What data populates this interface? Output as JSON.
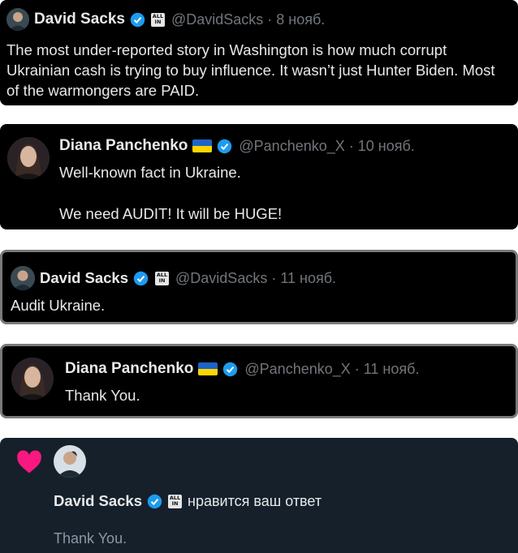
{
  "tweets": [
    {
      "name": "David Sacks",
      "handle": "@DavidSacks",
      "date": "· 8 нояб.",
      "text": "The most under-reported story in Washington is how much corrupt Ukrainian cash is trying to buy influence. It wasn’t just Hunter Biden. Most of the warmongers are PAID.",
      "badge": "ALL IN"
    },
    {
      "name": "Diana Panchenko",
      "handle": "@Panchenko_X",
      "date": "· 10 нояб.",
      "text": "Well-known fact in Ukraine.\n\nWe need AUDIT! It will be HUGE!"
    },
    {
      "name": "David Sacks",
      "handle": "@DavidSacks",
      "date": "· 11 нояб.",
      "text": "Audit Ukraine.",
      "badge": "ALL IN"
    },
    {
      "name": "Diana Panchenko",
      "handle": "@Panchenko_X",
      "date": "· 11 нояб.",
      "text": "Thank You."
    }
  ],
  "notification": {
    "name": "David Sacks",
    "action": "нравится ваш ответ",
    "quoted": "Thank You.",
    "badge": "ALL IN",
    "icon": "heart-icon",
    "background": "#15202b",
    "heart_color": "#f91880"
  },
  "colors": {
    "verified": "#1d9bf0",
    "handle": "#71767b",
    "flag_blue": "#1d64c8",
    "flag_yellow": "#ffd500"
  }
}
